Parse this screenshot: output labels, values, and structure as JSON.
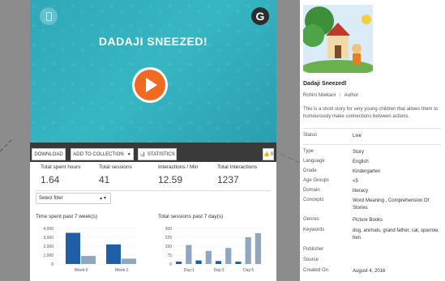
{
  "player": {
    "title": "DADAJI SNEEZED!",
    "brand_letter": "G"
  },
  "toolbar": {
    "download_label": "DOWNLOAD",
    "collection_label": "ADD TO COLLECTION",
    "stats_label": "STATISTICS",
    "like_count": "0"
  },
  "stats": {
    "items": [
      {
        "label": "Total spent hours",
        "value": "1.64"
      },
      {
        "label": "Total sessions",
        "value": "41"
      },
      {
        "label": "Interactions / Min",
        "value": "12.59"
      },
      {
        "label": "Total Interactions",
        "value": "1237"
      }
    ],
    "filter_label": "Select filter"
  },
  "chart_data": [
    {
      "type": "bar",
      "title": "Time spent past 7 week(s)",
      "categories": [
        "Week:0",
        "Week:1"
      ],
      "series": [
        {
          "values": [
            3500,
            2200
          ],
          "color": "#1f5fa8"
        },
        {
          "values": [
            900,
            600
          ],
          "color": "#8fa6bf"
        }
      ],
      "ylim": [
        0,
        4000
      ],
      "yticks": [
        "4,000",
        "3,000",
        "2,000",
        "1,000",
        "0"
      ]
    },
    {
      "type": "bar",
      "title": "Total sessions past 7 day(s)",
      "categories": [
        "Day:1",
        "Day:3",
        "Day:5"
      ],
      "values": [
        20,
        160,
        30,
        110,
        25,
        135,
        20,
        225,
        260
      ],
      "ylim": [
        0,
        300
      ],
      "yticks": [
        "300",
        "225",
        "150",
        "75",
        "0"
      ]
    }
  ],
  "book": {
    "title": "Dadaji Sneezed!",
    "author_name": "Rohini Nilekani",
    "author_role": "Author",
    "description": "This is a short story for very young children that allows them to humourously make connections between actions.",
    "meta": [
      {
        "label": "Status",
        "value": "Live"
      },
      {
        "label": "Type",
        "value": "Story"
      },
      {
        "label": "Language",
        "value": "English"
      },
      {
        "label": "Grade",
        "value": "Kindergarten"
      },
      {
        "label": "Age Groups",
        "value": "<5"
      },
      {
        "label": "Domain",
        "value": "literacy"
      },
      {
        "label": "Concepts",
        "value": "Word Meaning , Comprehension Of Stories"
      },
      {
        "label": "Genres",
        "value": "Picture Books"
      },
      {
        "label": "Keywords",
        "value": "dog, animals, grand father, cat, sparrow, hen"
      },
      {
        "label": "Publisher",
        "value": ""
      },
      {
        "label": "Source",
        "value": ""
      },
      {
        "label": "Created On",
        "value": "August 4, 2016"
      }
    ]
  }
}
